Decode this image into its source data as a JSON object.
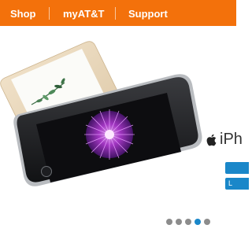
{
  "nav": {
    "items": [
      {
        "label": "Shop"
      },
      {
        "label": "myAT&T"
      },
      {
        "label": "Support"
      }
    ]
  },
  "hero": {
    "brand_text": "iPh",
    "cta_primary": "",
    "cta_secondary": "L",
    "carousel": {
      "count": 5,
      "active_index": 3
    }
  },
  "colors": {
    "accent": "#f3710b",
    "cta": "#1a87c9",
    "dot_inactive": "#8c8c8c"
  }
}
